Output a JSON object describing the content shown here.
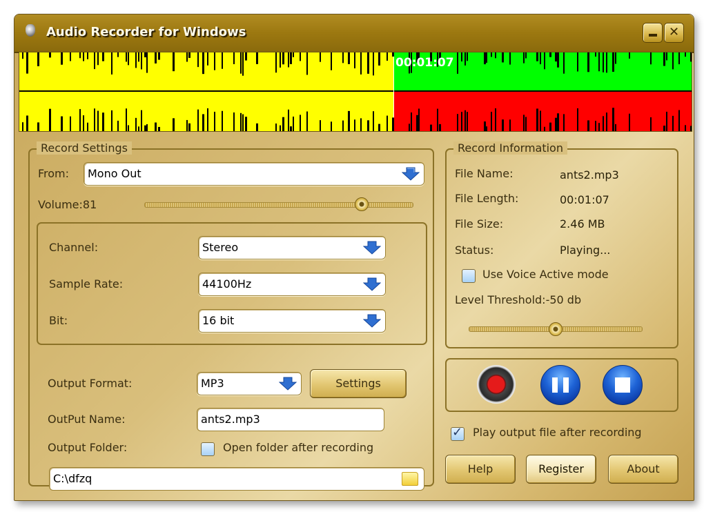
{
  "window": {
    "title": "Audio Recorder for Windows",
    "icon": "speaker-icon",
    "minimize_label": "_",
    "close_label": "✕"
  },
  "waveform": {
    "time": "00:01:07",
    "progress_fraction": 0.556,
    "played_color": "#ffff00",
    "left_channel_color": "#00ff00",
    "right_channel_color": "#ff0000"
  },
  "record_settings": {
    "legend": "Record Settings",
    "from_label": "From:",
    "from_value": "Mono Out",
    "volume_label": "Volume:81",
    "volume_value": 81,
    "channel_label": "Channel:",
    "channel_value": "Stereo",
    "sample_rate_label": "Sample Rate:",
    "sample_rate_value": "44100Hz",
    "bit_label": "Bit:",
    "bit_value": "16 bit",
    "output_format_label": "Output Format:",
    "output_format_value": "MP3",
    "settings_button": "Settings",
    "output_name_label": "OutPut Name:",
    "output_name_value": "ants2.mp3",
    "output_folder_label": "Output Folder:",
    "open_folder_label": "Open folder after recording",
    "open_folder_checked": false,
    "folder_path": "C:\\dfzq"
  },
  "record_info": {
    "legend": "Record Information",
    "file_name_label": "File Name:",
    "file_name_value": "ants2.mp3",
    "file_length_label": "File Length:",
    "file_length_value": "00:01:07",
    "file_size_label": "File Size:",
    "file_size_value": "2.46 MB",
    "status_label": "Status:",
    "status_value": "Playing...",
    "voice_active_label": "Use Voice Active mode",
    "voice_active_checked": false,
    "level_threshold_label": "Level Threshold:-50 db",
    "level_threshold_fraction": 0.5
  },
  "controls": {
    "record": "record-button",
    "pause": "pause-button",
    "stop": "stop-button"
  },
  "play_after_label": "Play output file after recording",
  "play_after_checked": true,
  "buttons": {
    "help": "Help",
    "register": "Register",
    "about": "About"
  }
}
